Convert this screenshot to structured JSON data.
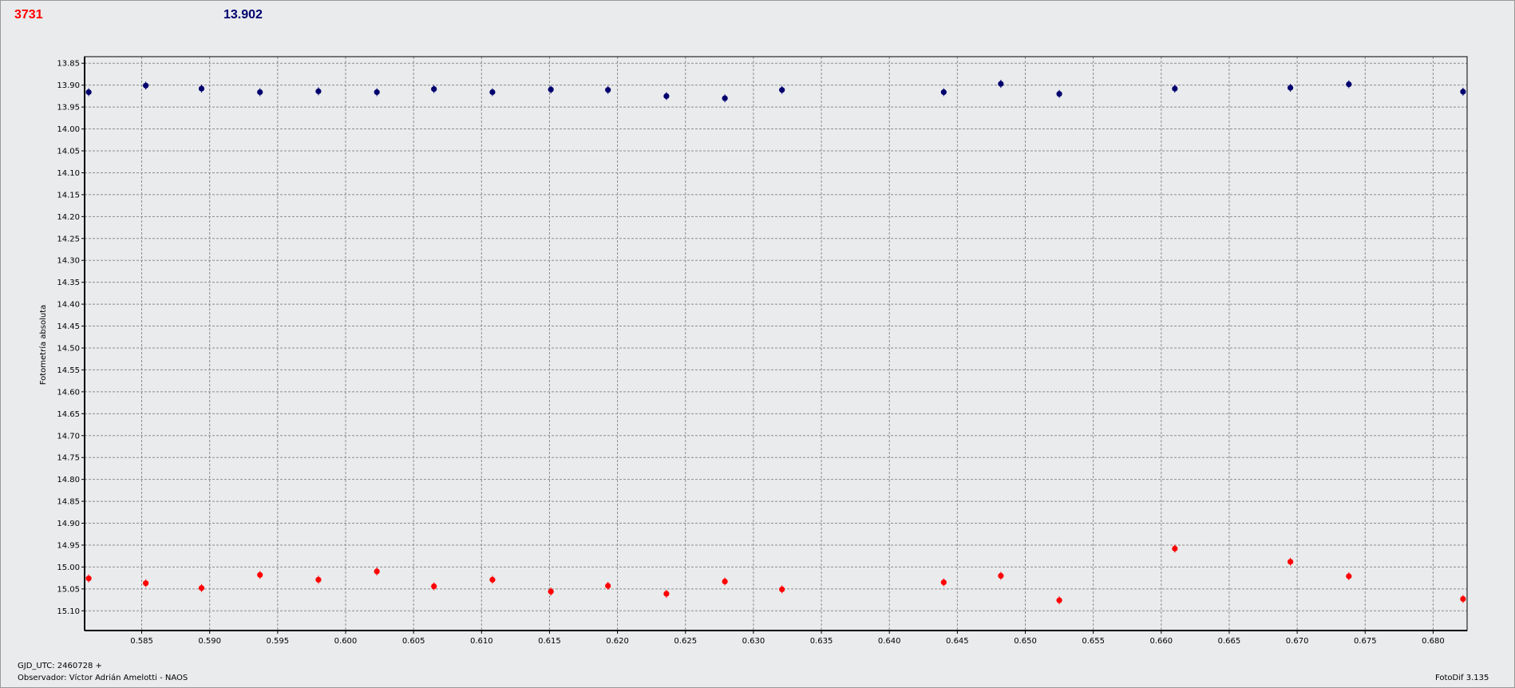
{
  "header": {
    "red_value": "3731",
    "blue_value": "13.902"
  },
  "footer": {
    "gjd": "GJD_UTC: 2460728 +",
    "observer": "Observador: Víctor Adrián Amelotti - NAOS",
    "version": "FotoDif 3.135"
  },
  "colors": {
    "red_series": "#ff0000",
    "blue_series": "#00006e",
    "grid": "#888888",
    "background": "#e9ebed"
  },
  "chart_data": {
    "type": "scatter",
    "ylabel": "Fotometría absoluta",
    "xlabel": "",
    "xlim": [
      0.5808,
      0.6825
    ],
    "ylim": [
      13.835,
      15.145
    ],
    "y_inverted": true,
    "grid": true,
    "xticks": [
      0.585,
      0.59,
      0.595,
      0.6,
      0.605,
      0.61,
      0.615,
      0.62,
      0.625,
      0.63,
      0.635,
      0.64,
      0.645,
      0.65,
      0.655,
      0.66,
      0.665,
      0.67,
      0.675,
      0.68
    ],
    "xtick_labels": [
      "0.585",
      "0.590",
      "0.595",
      "0.600",
      "0.605",
      "0.610",
      "0.615",
      "0.620",
      "0.625",
      "0.630",
      "0.635",
      "0.640",
      "0.645",
      "0.650",
      "0.655",
      "0.660",
      "0.665",
      "0.670",
      "0.675",
      "0.680"
    ],
    "yticks": [
      13.85,
      13.9,
      13.95,
      14.0,
      14.05,
      14.1,
      14.15,
      14.2,
      14.25,
      14.3,
      14.35,
      14.4,
      14.45,
      14.5,
      14.55,
      14.6,
      14.65,
      14.7,
      14.75,
      14.8,
      14.85,
      14.9,
      14.95,
      15.0,
      15.05,
      15.1
    ],
    "ytick_labels": [
      "13.85",
      "13.90",
      "13.95",
      "14.00",
      "14.05",
      "14.10",
      "14.15",
      "14.20",
      "14.25",
      "14.30",
      "14.35",
      "14.40",
      "14.45",
      "14.50",
      "14.55",
      "14.60",
      "14.65",
      "14.70",
      "14.75",
      "14.80",
      "14.85",
      "14.90",
      "14.95",
      "15.00",
      "15.05",
      "15.10"
    ],
    "series": [
      {
        "color": "#00006e",
        "x": [
          0.5811,
          0.5853,
          0.5894,
          0.5937,
          0.598,
          0.6023,
          0.6065,
          0.6108,
          0.6151,
          0.6193,
          0.6236,
          0.6279,
          0.6321,
          0.644,
          0.6482,
          0.6525,
          0.661,
          0.6695,
          0.6738,
          0.6822
        ],
        "y": [
          13.916,
          13.901,
          13.908,
          13.916,
          13.914,
          13.916,
          13.909,
          13.916,
          13.91,
          13.911,
          13.925,
          13.93,
          13.911,
          13.916,
          13.897,
          13.92,
          13.908,
          13.906,
          13.898,
          13.915
        ]
      },
      {
        "color": "#ff0000",
        "x": [
          0.5811,
          0.5853,
          0.5894,
          0.5937,
          0.598,
          0.6023,
          0.6065,
          0.6108,
          0.6151,
          0.6193,
          0.6236,
          0.6279,
          0.6321,
          0.644,
          0.6482,
          0.6525,
          0.661,
          0.6695,
          0.6738,
          0.6822
        ],
        "y": [
          15.026,
          15.037,
          15.048,
          15.018,
          15.029,
          15.01,
          15.044,
          15.029,
          15.056,
          15.043,
          15.061,
          15.033,
          15.051,
          15.035,
          15.02,
          15.076,
          14.958,
          14.988,
          15.021,
          15.073
        ]
      }
    ]
  }
}
